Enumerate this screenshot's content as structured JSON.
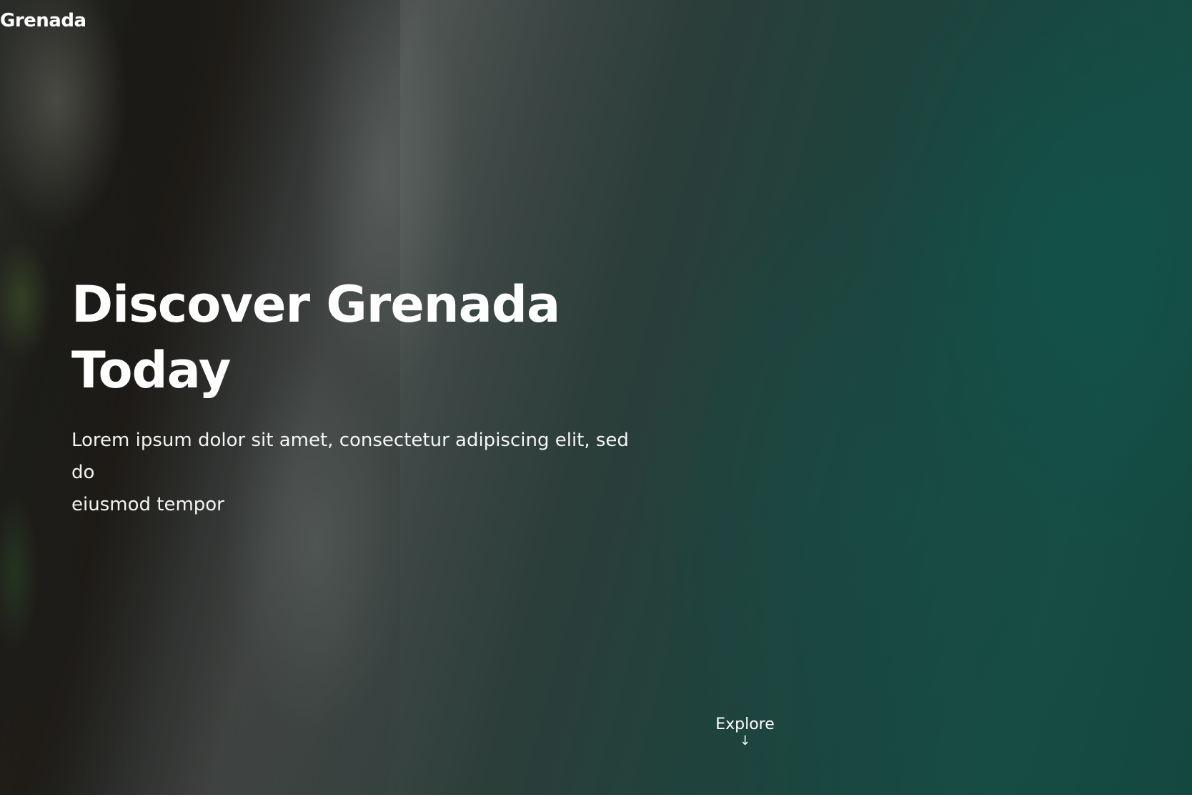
{
  "header": {
    "brand": "Grenada"
  },
  "hero": {
    "title_line1": "Discover Grenada",
    "title_line2": "Today",
    "subtitle_line1": "Lorem ipsum dolor sit amet, consectetur adipiscing elit, sed do",
    "subtitle_line2": "eiusmod tempor",
    "background": "aerial-coastline-video"
  },
  "explore": {
    "label": "Explore",
    "icon": "arrow-down-icon",
    "glyph": "↓"
  },
  "colors": {
    "text": "#ffffff",
    "water": "#1f6a5f"
  }
}
